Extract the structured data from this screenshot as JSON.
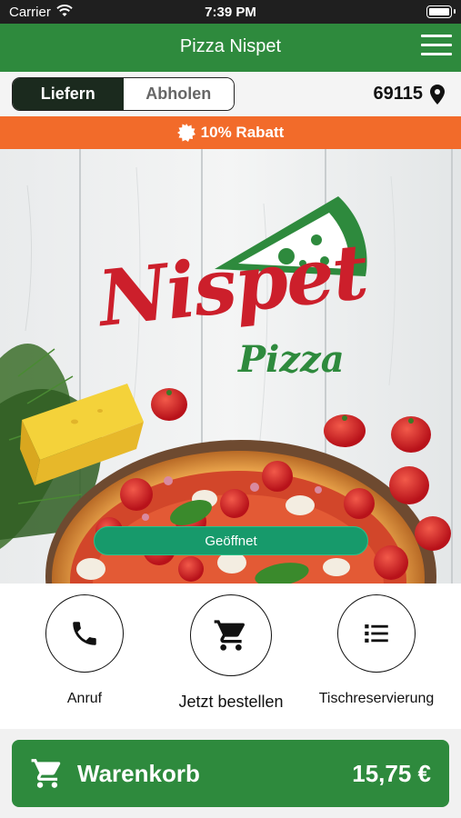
{
  "status_bar": {
    "carrier": "Carrier",
    "time": "7:39 PM"
  },
  "header": {
    "title": "Pizza Nispet",
    "menu_icon": "hamburger-menu-icon"
  },
  "mode": {
    "deliver_label": "Liefern",
    "pickup_label": "Abholen",
    "selected": "Liefern",
    "zip": "69115",
    "location_icon": "map-pin-icon"
  },
  "discount": {
    "label": "10% Rabatt",
    "icon": "badge-icon"
  },
  "hero": {
    "logo_script": "Nispet",
    "logo_sub": "Pizza",
    "status_label": "Geöffnet"
  },
  "actions": {
    "call_label": "Anruf",
    "order_label": "Jetzt bestellen",
    "reserve_label": "Tischreservierung"
  },
  "cart": {
    "label": "Warenkorb",
    "total": "15,75 €",
    "icon": "cart-icon"
  },
  "colors": {
    "brand_green": "#2e8a3d",
    "discount_orange": "#f26b2a",
    "open_green": "#179a6b",
    "logo_red": "#cc1f2b"
  }
}
